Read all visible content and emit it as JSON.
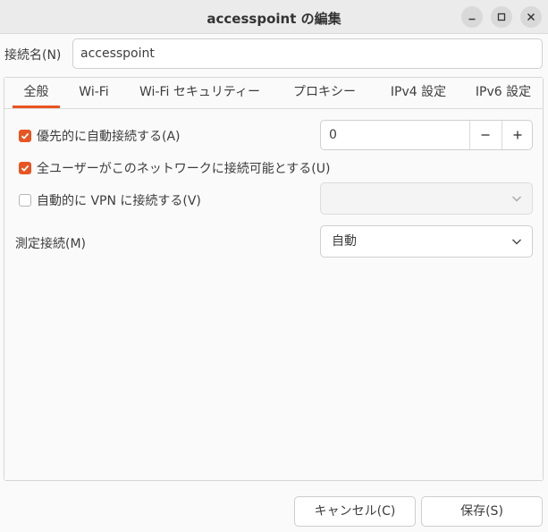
{
  "window": {
    "title": "accesspoint の編集"
  },
  "connection": {
    "name_label": "接続名(N)",
    "name_value": "accesspoint"
  },
  "tabs": [
    {
      "label": "全般",
      "active": true
    },
    {
      "label": "Wi-Fi",
      "active": false
    },
    {
      "label": "Wi-Fi セキュリティー",
      "active": false
    },
    {
      "label": "プロキシー",
      "active": false
    },
    {
      "label": "IPv4 設定",
      "active": false
    },
    {
      "label": "IPv6 設定",
      "active": false
    }
  ],
  "general": {
    "auto_connect": {
      "label": "優先的に自動接続する(A)",
      "checked": true
    },
    "priority": {
      "value": "0",
      "decrement": "−",
      "increment": "+"
    },
    "all_users": {
      "label": "全ユーザーがこのネットワークに接続可能とする(U)",
      "checked": true
    },
    "auto_vpn": {
      "label": "自動的に VPN に接続する(V)",
      "checked": false,
      "selected": ""
    },
    "metered": {
      "label": "測定接続(M)",
      "selected": "自動"
    }
  },
  "buttons": {
    "cancel": "キャンセル(C)",
    "save": "保存(S)"
  },
  "colors": {
    "accent": "#e95420",
    "titlebar": "#ebebeb",
    "background": "#fafafa"
  },
  "icons": {
    "minimize": "minimize-icon",
    "maximize": "maximize-icon",
    "close": "close-icon",
    "check": "check-icon",
    "dropdown": "chevron-down-icon"
  }
}
